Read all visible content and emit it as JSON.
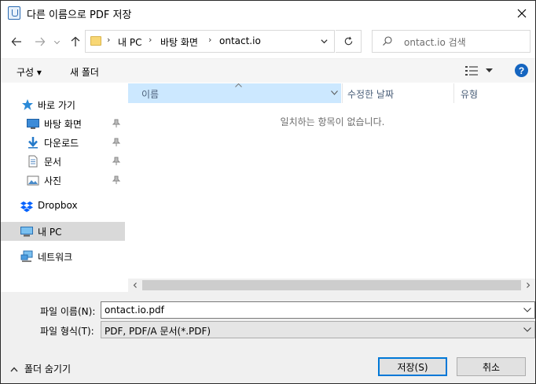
{
  "window": {
    "title": "다른 이름으로 PDF 저장"
  },
  "address": {
    "crumbs": [
      "내 PC",
      "바탕 화면",
      "ontact.io"
    ],
    "search_placeholder": "ontact.io 검색"
  },
  "toolbar": {
    "organize_label": "구성 ▾",
    "new_folder_label": "새 폴더"
  },
  "nav": {
    "quick_access": "바로 가기",
    "items": [
      {
        "label": "바탕 화면",
        "icon": "desktop-icon",
        "pinned": true
      },
      {
        "label": "다운로드",
        "icon": "download-icon",
        "pinned": true
      },
      {
        "label": "문서",
        "icon": "document-icon",
        "pinned": true
      },
      {
        "label": "사진",
        "icon": "pictures-icon",
        "pinned": true
      }
    ],
    "dropbox": "Dropbox",
    "this_pc": "내 PC",
    "network": "네트워크"
  },
  "list": {
    "columns": [
      "이름",
      "수정한 날짜",
      "유형"
    ],
    "empty_message": "일치하는 항목이 없습니다."
  },
  "form": {
    "filename_label": "파일 이름(N):",
    "filename_value": "ontact.io.pdf",
    "filetype_label": "파일 형식(T):",
    "filetype_value": "PDF, PDF/A 문서(*.PDF)"
  },
  "footer": {
    "hide_folders_label": "폴더 숨기기",
    "save_label": "저장(S)",
    "cancel_label": "취소"
  },
  "colors": {
    "selection": "#cce8ff",
    "accent": "#0078d7",
    "help": "#1565c0"
  }
}
